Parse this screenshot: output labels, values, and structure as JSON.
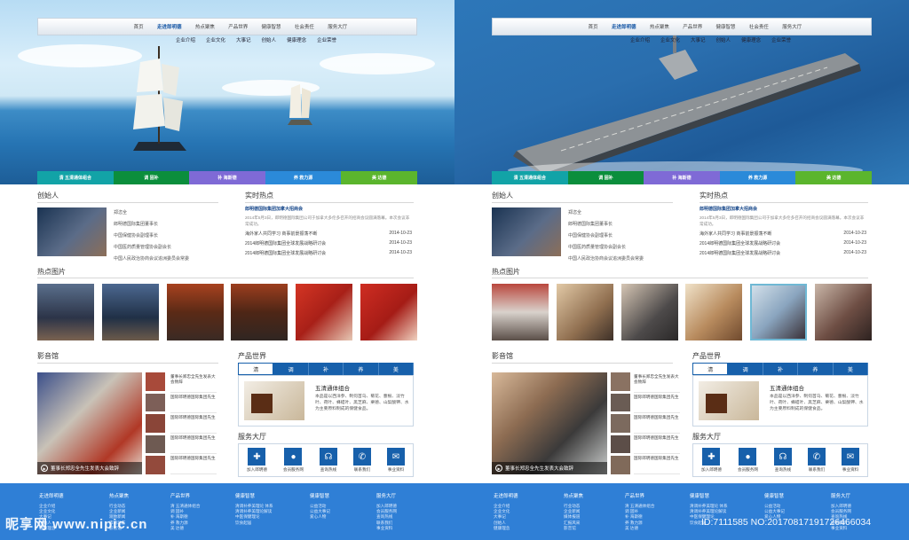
{
  "left": {
    "top_nav": [
      "首页",
      "走进郎明德",
      "热点聚焦",
      "产品世界",
      "健康智慧",
      "社会责任",
      "服务大厅"
    ],
    "top_nav_active": 1,
    "sub_nav": [
      "企业介绍",
      "企业文化",
      "大事记",
      "创始人",
      "健康理念",
      "企业荣誉"
    ],
    "banner_tabs": [
      {
        "label": "清 五清通体组合",
        "color": "#12a3a7"
      },
      {
        "label": "调 固补",
        "color": "#0b8e3c"
      },
      {
        "label": "补 海斯德",
        "color": "#7f6ad6"
      },
      {
        "label": "养 救力源",
        "color": "#2b8ad9"
      },
      {
        "label": "美 达德",
        "color": "#5bb52d"
      }
    ],
    "founder": {
      "title": "创始人",
      "name": "郑恣全",
      "lines": [
        "郎明德国际集团董事长",
        "中国保健协会副理事长",
        "中国医药质量管理协会副会长",
        "中国人民政治协商会议追洲委员会常委"
      ]
    },
    "news": {
      "title": "实时热点",
      "lead": "郎明德国际集团加拿大招商会",
      "lead_desc": "2014年5月3日，郎明德国际集团公司于加拿大多伦多召开的招商会议圆满落幕。本次会议非常成功。",
      "items": [
        {
          "text": "海外家人共同学习 商事前景振荡不断",
          "date": "2014-10-23"
        },
        {
          "text": "2014郎明德国际集团全球发展战略研讨会",
          "date": "2014-10-23"
        },
        {
          "text": "2014郎明德国际集团全球发展战略研讨会",
          "date": "2014-10-23"
        }
      ]
    },
    "photos_title": "热点图片",
    "video": {
      "title": "影音馆",
      "caption": "董事长郑忠全先生发表大会致辞",
      "list": [
        "董事长郑忠全先生发表大会致辞",
        "国际郎明德国际集团先生",
        "国际郎明德国际集团先生",
        "国际郎明德国际集团先生",
        "国际郎明德国际集团先生"
      ]
    },
    "products": {
      "title": "产品世界",
      "tabs": [
        "清",
        "调",
        "补",
        "养",
        "美"
      ],
      "active": 0,
      "name": "五清通体组合",
      "desc": "本品是以西洋参、制何首乌、菊花、薏根、淡竹叶、荷叶、蜂蜡叶、黑芝麻、栗德、山梨酸钾、水为主要原料制成的保健食品。"
    },
    "services": {
      "title": "服务大厅",
      "items": [
        {
          "label": "加入郎明德",
          "icon": "plus-icon",
          "glyph": "✚"
        },
        {
          "label": "会员服务网",
          "icon": "user-icon",
          "glyph": "👤"
        },
        {
          "label": "查询热线",
          "icon": "headset-icon",
          "glyph": "☊"
        },
        {
          "label": "联系我们",
          "icon": "phone-icon",
          "glyph": "✆"
        },
        {
          "label": "事业资料",
          "icon": "document-icon",
          "glyph": "✉"
        }
      ]
    },
    "footer": [
      {
        "head": "走进郎明德",
        "items": [
          "企业介绍",
          "企业文化",
          "大事记",
          "创始人",
          "健康理念"
        ]
      },
      {
        "head": "热点聚焦",
        "items": [
          "行业动态",
          "企业新闻",
          "观致新闻",
          "市场动态",
          "影音馆"
        ]
      },
      {
        "head": "产品世界",
        "items": [
          "清 五清通体组合",
          "调 固补",
          "补 海斯德",
          "养 救力源",
          "美 达德"
        ]
      },
      {
        "head": "健康智慧",
        "items": [
          "清调补养美理论 体系",
          "清调补养美理论解读",
          "中医保健理论",
          "饮食起居"
        ]
      },
      {
        "head": "健康智慧",
        "items": [
          "公益活动",
          "公益大事记",
          "爱心人物"
        ]
      },
      {
        "head": "服务大厅",
        "items": [
          "加入郎明德",
          "会员服务网",
          "查询热线",
          "联系我们",
          "事业资料"
        ]
      }
    ]
  },
  "right": {
    "top_nav": [
      "首页",
      "走进郎明德",
      "热点聚焦",
      "产品世界",
      "健康智慧",
      "社会责任",
      "服务大厅"
    ],
    "top_nav_active": 1,
    "sub_nav": [
      "企业介绍",
      "企业文化",
      "大事记",
      "创始人",
      "健康理念",
      "企业荣誉"
    ],
    "banner_tabs": [
      {
        "label": "清 五清通体组合",
        "color": "#12a3a7"
      },
      {
        "label": "调 固补",
        "color": "#0b8e3c"
      },
      {
        "label": "补 海斯德",
        "color": "#7f6ad6"
      },
      {
        "label": "养 救力源",
        "color": "#2b8ad9"
      },
      {
        "label": "美 达德",
        "color": "#5bb52d"
      }
    ],
    "founder": {
      "title": "创始人",
      "name": "郑恣全",
      "lines": [
        "郎明德国际集团董事长",
        "中国保健协会副理事长",
        "中国医药质量管理协会副会长",
        "中国人民政治协商会议追洲委员会常委"
      ]
    },
    "news": {
      "title": "实时热点",
      "lead": "郎明德国际集团加拿大招商会",
      "lead_desc": "2014年5月3日，郎明德国际集团公司于加拿大多伦多召开的招商会议圆满落幕。本次会议非常成功。",
      "items": [
        {
          "text": "海外家人共同学习 商事前景振荡不断",
          "date": "2014-10-23"
        },
        {
          "text": "2014郎明德国际集团全球发展战略研讨会",
          "date": "2014-10-23"
        },
        {
          "text": "2014郎明德国际集团全球发展战略研讨会",
          "date": "2014-10-23"
        }
      ]
    },
    "photos_title": "热点图片",
    "video": {
      "title": "影音馆",
      "caption": "董事长郑忠全先生发表大会致辞",
      "list": [
        "董事长郑忠全先生发表大会致辞",
        "国际郎明德国际集团先生",
        "国际郎明德国际集团先生",
        "国际郎明德国际集团先生",
        "国际郎明德国际集团先生"
      ]
    },
    "products": {
      "title": "产品世界",
      "tabs": [
        "清",
        "调",
        "补",
        "养",
        "美"
      ],
      "active": 0,
      "name": "五清通体组合",
      "desc": "本品是以西洋参、制何首乌、菊花、薏根、淡竹叶、荷叶、蜂蜡叶、黑芝麻、栗德、山梨酸钾、水为主要原料制成的保健食品。"
    },
    "services": {
      "title": "服务大厅",
      "items": [
        {
          "label": "加入郎明德",
          "icon": "plus-icon",
          "glyph": "✚"
        },
        {
          "label": "会员服务网",
          "icon": "user-icon",
          "glyph": "👤"
        },
        {
          "label": "查询热线",
          "icon": "headset-icon",
          "glyph": "☊"
        },
        {
          "label": "联系我们",
          "icon": "phone-icon",
          "glyph": "✆"
        },
        {
          "label": "事业资料",
          "icon": "document-icon",
          "glyph": "✉"
        }
      ]
    },
    "footer": [
      {
        "head": "走进郎明德",
        "items": [
          "企业介绍",
          "企业文化",
          "大事记",
          "创始人",
          "健康理念"
        ]
      },
      {
        "head": "热点聚焦",
        "items": [
          "行业动态",
          "企业新闻",
          "媒体报道",
          "汇报风采",
          "影音馆"
        ]
      },
      {
        "head": "产品世界",
        "items": [
          "清 五清通体组合",
          "调 固补",
          "补 海斯德",
          "养 救力源",
          "美 达德"
        ]
      },
      {
        "head": "健康智慧",
        "items": [
          "清调补养美理论 体系",
          "清调补养美理论解读",
          "中医保健理论",
          "饮食起居"
        ]
      },
      {
        "head": "健康智慧",
        "items": [
          "公益活动",
          "公益大事记",
          "爱心人物"
        ]
      },
      {
        "head": "服务大厅",
        "items": [
          "加入郎明德",
          "会员服务网",
          "查询热线",
          "联系我们",
          "事业资料"
        ]
      }
    ]
  },
  "watermark": {
    "logo": "昵享网 www.nipic.cn",
    "id": "ID:7111585 NO:20170817191726466034"
  },
  "colors": {
    "nav_blue": "#1760ab",
    "footer_blue": "#2f7fd6"
  }
}
